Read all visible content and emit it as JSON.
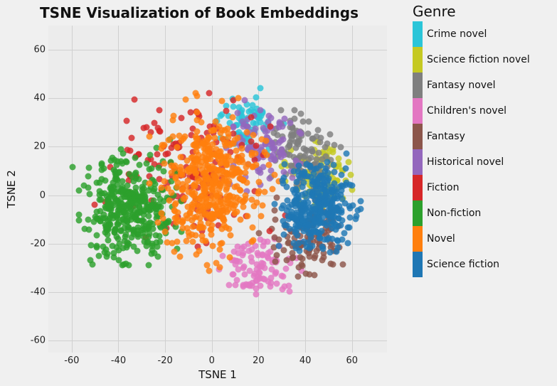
{
  "chart_data": {
    "type": "scatter",
    "title": "TSNE Visualization of Book Embeddings",
    "xlabel": "TSNE 1",
    "ylabel": "TSNE 2",
    "xlim": [
      -70,
      75
    ],
    "ylim": [
      -65,
      70
    ],
    "xticks": [
      -60,
      -40,
      -20,
      0,
      20,
      40,
      60
    ],
    "yticks": [
      -60,
      -40,
      -20,
      0,
      20,
      40,
      60
    ],
    "legend_title": "Genre",
    "series": [
      {
        "name": "Crime novel",
        "color": "#2bc5d8",
        "cluster": {
          "cx": 15,
          "cy": 30,
          "rx": 22,
          "ry": 18,
          "n": 70
        }
      },
      {
        "name": "Science fiction novel",
        "color": "#c5c922",
        "cluster": {
          "cx": 45,
          "cy": 8,
          "rx": 20,
          "ry": 22,
          "n": 110
        }
      },
      {
        "name": "Fantasy novel",
        "color": "#7f7f7f",
        "cluster": {
          "cx": 38,
          "cy": 18,
          "rx": 22,
          "ry": 24,
          "n": 110
        }
      },
      {
        "name": "Children's novel",
        "color": "#e377c2",
        "cluster": {
          "cx": 20,
          "cy": -30,
          "rx": 24,
          "ry": 20,
          "n": 100
        }
      },
      {
        "name": "Fantasy",
        "color": "#8c564b",
        "cluster": {
          "cx": 40,
          "cy": -18,
          "rx": 24,
          "ry": 22,
          "n": 120
        }
      },
      {
        "name": "Historical novel",
        "color": "#9467bd",
        "cluster": {
          "cx": 22,
          "cy": 22,
          "rx": 24,
          "ry": 24,
          "n": 100
        }
      },
      {
        "name": "Fiction",
        "color": "#d62728",
        "cluster": {
          "cx": -10,
          "cy": 10,
          "rx": 50,
          "ry": 45,
          "n": 150
        }
      },
      {
        "name": "Non-fiction",
        "color": "#2ca02c",
        "cluster": {
          "cx": -35,
          "cy": -5,
          "rx": 30,
          "ry": 38,
          "n": 400
        }
      },
      {
        "name": "Novel",
        "color": "#ff7f0e",
        "cluster": {
          "cx": 0,
          "cy": 5,
          "rx": 35,
          "ry": 48,
          "n": 450
        }
      },
      {
        "name": "Science fiction",
        "color": "#1f77b4",
        "cluster": {
          "cx": 45,
          "cy": -5,
          "rx": 26,
          "ry": 28,
          "n": 350
        }
      }
    ]
  }
}
